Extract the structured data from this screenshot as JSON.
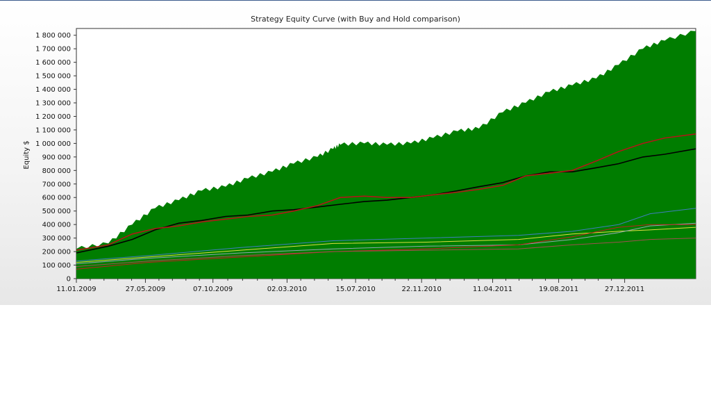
{
  "chart_data": {
    "type": "area",
    "title": "Strategy Equity Curve (with Buy and Hold comparison)",
    "xlabel": "",
    "ylabel": "Equity $",
    "ylim": [
      0,
      1850000
    ],
    "yticks": [
      0,
      100000,
      200000,
      300000,
      400000,
      500000,
      600000,
      700000,
      800000,
      900000,
      1000000,
      1100000,
      1200000,
      1300000,
      1400000,
      1500000,
      1600000,
      1700000,
      1800000
    ],
    "ytick_labels": [
      "0",
      "100 000",
      "200 000",
      "300 000",
      "400 000",
      "500 000",
      "600 000",
      "700 000",
      "800 000",
      "900 000",
      "1 000 000",
      "1 100 000",
      "1 200 000",
      "1 300 000",
      "1 400 000",
      "1 500 000",
      "1 600 000",
      "1 700 000",
      "1 800 000"
    ],
    "xlim": [
      "2009-01-11",
      "2012-05-15"
    ],
    "x_tick_labels": [
      "11.01.2009",
      "27.05.2009",
      "07.10.2009",
      "02.03.2010",
      "15.07.2010",
      "22.11.2010",
      "11.04.2011",
      "19.08.2011",
      "27.12.2011"
    ],
    "x_tick_dates": [
      "2009-01-11",
      "2009-05-27",
      "2009-10-07",
      "2010-03-02",
      "2010-07-15",
      "2010-11-22",
      "2011-04-11",
      "2011-08-19",
      "2011-12-27"
    ],
    "grid": false,
    "legend": "none",
    "series": [
      {
        "kind": "area",
        "color": "#007d00",
        "x": [
          "2009-01-11",
          "2009-03-15",
          "2009-05-01",
          "2009-06-15",
          "2009-08-01",
          "2009-09-15",
          "2009-11-01",
          "2009-12-15",
          "2010-02-01",
          "2010-03-15",
          "2010-05-01",
          "2010-06-01",
          "2010-06-15",
          "2010-08-01",
          "2010-09-15",
          "2010-11-01",
          "2010-12-15",
          "2011-02-01",
          "2011-03-15",
          "2011-05-01",
          "2011-06-15",
          "2011-08-01",
          "2011-09-15",
          "2011-11-01",
          "2011-12-15",
          "2012-02-01",
          "2012-03-15",
          "2012-05-15"
        ],
        "y": [
          220000,
          260000,
          400000,
          520000,
          580000,
          650000,
          680000,
          740000,
          790000,
          850000,
          900000,
          960000,
          990000,
          1000000,
          990000,
          1000000,
          1040000,
          1090000,
          1110000,
          1230000,
          1300000,
          1380000,
          1430000,
          1480000,
          1580000,
          1700000,
          1760000,
          1830000
        ]
      },
      {
        "kind": "line",
        "color": "#000000",
        "x": [
          "2009-01-11",
          "2009-03-15",
          "2009-05-01",
          "2009-06-15",
          "2009-08-01",
          "2009-09-15",
          "2009-11-01",
          "2009-12-15",
          "2010-02-01",
          "2010-03-15",
          "2010-05-01",
          "2010-06-15",
          "2010-08-01",
          "2010-09-15",
          "2010-11-01",
          "2010-12-15",
          "2011-02-01",
          "2011-03-15",
          "2011-05-01",
          "2011-06-15",
          "2011-08-01",
          "2011-09-15",
          "2011-11-01",
          "2011-12-15",
          "2012-02-01",
          "2012-03-15",
          "2012-05-15"
        ],
        "y": [
          190000,
          240000,
          290000,
          360000,
          410000,
          430000,
          460000,
          470000,
          500000,
          510000,
          530000,
          550000,
          570000,
          580000,
          600000,
          620000,
          650000,
          680000,
          710000,
          760000,
          790000,
          790000,
          820000,
          850000,
          900000,
          920000,
          960000
        ]
      },
      {
        "kind": "line",
        "color": "#b01818",
        "x": [
          "2009-01-11",
          "2009-03-15",
          "2009-05-01",
          "2009-06-15",
          "2009-08-01",
          "2009-09-15",
          "2009-11-01",
          "2009-12-15",
          "2010-02-01",
          "2010-03-15",
          "2010-05-01",
          "2010-06-15",
          "2010-08-01",
          "2010-09-15",
          "2010-11-01",
          "2010-12-15",
          "2011-02-01",
          "2011-03-15",
          "2011-05-01",
          "2011-06-15",
          "2011-08-01",
          "2011-09-15",
          "2011-11-01",
          "2011-12-15",
          "2012-02-01",
          "2012-03-15",
          "2012-05-15"
        ],
        "y": [
          210000,
          250000,
          330000,
          370000,
          390000,
          420000,
          440000,
          460000,
          470000,
          500000,
          540000,
          600000,
          610000,
          600000,
          600000,
          620000,
          640000,
          660000,
          690000,
          760000,
          780000,
          800000,
          870000,
          940000,
          1000000,
          1040000,
          1070000
        ]
      },
      {
        "kind": "line",
        "color": "#3f7fbf",
        "x": [
          "2009-01-11",
          "2009-06-01",
          "2009-12-01",
          "2010-06-01",
          "2010-12-01",
          "2011-06-01",
          "2011-09-15",
          "2011-12-15",
          "2012-02-15",
          "2012-05-15"
        ],
        "y": [
          130000,
          170000,
          230000,
          280000,
          300000,
          320000,
          350000,
          400000,
          480000,
          520000
        ]
      },
      {
        "kind": "line",
        "color": "#e0e040",
        "x": [
          "2009-01-11",
          "2009-06-01",
          "2009-12-01",
          "2010-06-01",
          "2010-12-01",
          "2011-06-01",
          "2011-09-15",
          "2011-12-15",
          "2012-02-15",
          "2012-05-15"
        ],
        "y": [
          120000,
          160000,
          210000,
          260000,
          270000,
          290000,
          330000,
          350000,
          360000,
          380000
        ]
      },
      {
        "kind": "line",
        "color": "#8fa8b0",
        "x": [
          "2009-01-11",
          "2009-06-01",
          "2009-12-01",
          "2010-06-01",
          "2010-12-01",
          "2011-06-01",
          "2011-09-15",
          "2011-12-15",
          "2012-02-15",
          "2012-05-15"
        ],
        "y": [
          110000,
          150000,
          190000,
          220000,
          240000,
          250000,
          290000,
          340000,
          390000,
          410000
        ]
      },
      {
        "kind": "line",
        "color": "#c02020",
        "x": [
          "2009-01-11",
          "2009-06-01",
          "2009-12-01",
          "2010-06-01",
          "2010-12-01",
          "2011-06-01",
          "2011-09-15",
          "2011-12-15",
          "2012-02-15",
          "2012-05-15"
        ],
        "y": [
          70000,
          120000,
          160000,
          200000,
          220000,
          250000,
          310000,
          380000,
          400000,
          400000
        ]
      },
      {
        "kind": "line",
        "color": "#a05050",
        "x": [
          "2009-01-11",
          "2009-06-01",
          "2009-12-01",
          "2010-06-01",
          "2010-12-01",
          "2011-06-01",
          "2011-09-15",
          "2011-12-15",
          "2012-02-15",
          "2012-05-15"
        ],
        "y": [
          90000,
          130000,
          170000,
          200000,
          210000,
          220000,
          250000,
          270000,
          290000,
          300000
        ]
      }
    ]
  }
}
